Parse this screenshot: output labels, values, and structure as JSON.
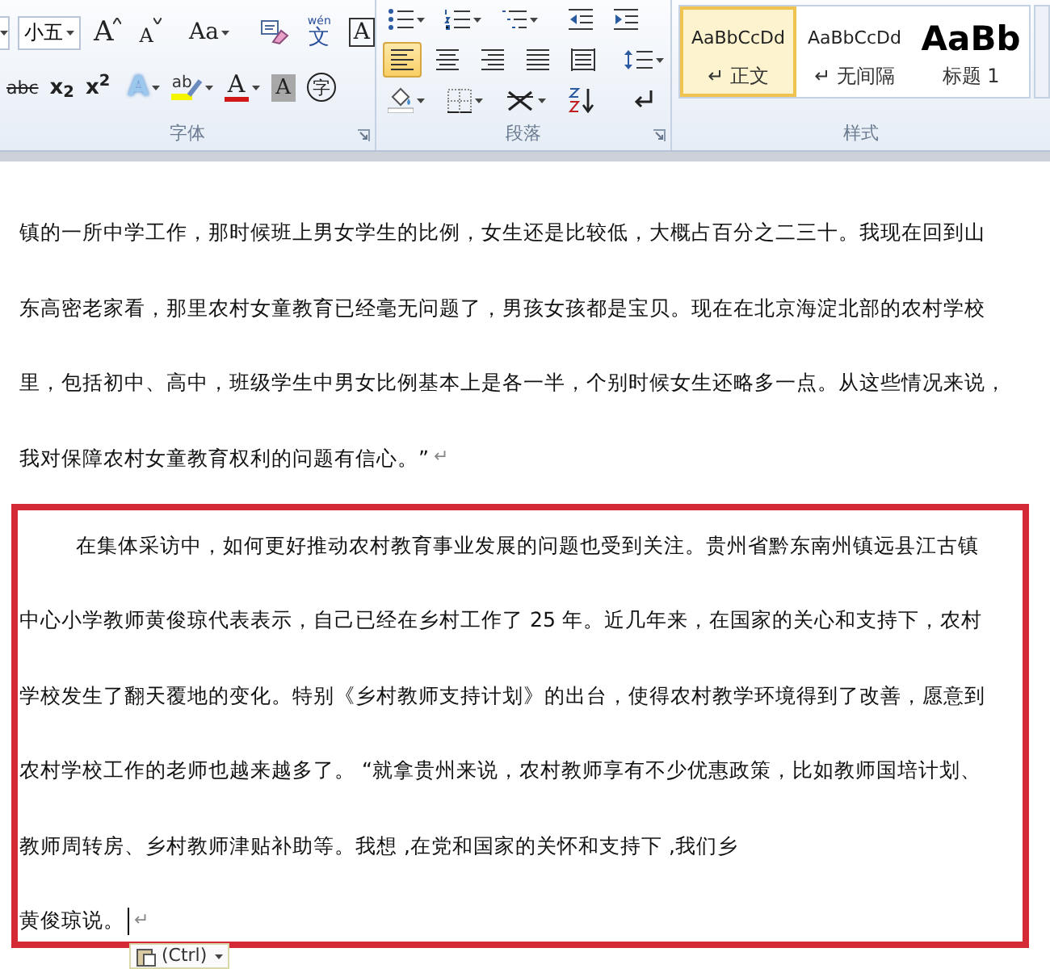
{
  "ribbon": {
    "font": {
      "label": "字体",
      "font_size": "小五",
      "buttons": [
        {
          "kind": "grow",
          "text": "A"
        },
        {
          "kind": "shrink",
          "text": "A"
        },
        {
          "kind": "case",
          "text": "Aa"
        },
        {
          "kind": "clear"
        },
        {
          "kind": "phonetic",
          "ruby": "wén",
          "text": "文"
        },
        {
          "kind": "border",
          "text": "A"
        },
        {
          "kind": "strike",
          "text": "abc"
        },
        {
          "kind": "sub",
          "text": "x$_{2}$"
        },
        {
          "kind": "sup",
          "text": "x$^{2}$"
        },
        {
          "kind": "effects",
          "text": "A"
        },
        {
          "kind": "highlight",
          "text": "ab"
        },
        {
          "kind": "color",
          "text": "A"
        },
        {
          "kind": "shading",
          "text": "A"
        },
        {
          "kind": "enclose",
          "text": "字"
        }
      ]
    },
    "paragraph": {
      "label": "段落",
      "alignment": [
        {
          "kind": "left",
          "selected": true
        },
        {
          "kind": "center",
          "selected": false
        },
        {
          "kind": "right",
          "selected": false
        },
        {
          "kind": "justify",
          "selected": false
        },
        {
          "kind": "distributed",
          "selected": false
        }
      ]
    },
    "styles": {
      "label": "样式",
      "items": [
        {
          "kind": "body",
          "preview": "AaBbCcDd",
          "name": "正文",
          "mark": "↵",
          "selected": true
        },
        {
          "kind": "body",
          "preview": "AaBbCcDd",
          "name": "无间隔",
          "mark": "↵",
          "selected": false
        },
        {
          "kind": "heading",
          "preview": "AaBb",
          "name": "标题 1",
          "selected": false
        }
      ]
    }
  },
  "document": {
    "paragraphs": [
      {
        "indent": false,
        "highlighted": false,
        "cursor": false,
        "mark": "↵",
        "lines": [
          "镇的一所中学工作，那时候班上男女学生的比例，女生还是比较低，大概占百分之二三十。我现在回到山",
          "东高密老家看，那里农村女童教育已经毫无问题了，男孩女孩都是宝贝。现在在北京海淀北部的农村学校",
          "里，包括初中、高中，班级学生中男女比例基本上是各一半，个别时候女生还略多一点。从这些情况来说，",
          "我对保障农村女童教育权利的问题有信心。”"
        ]
      },
      {
        "indent": true,
        "highlighted": true,
        "cursor": true,
        "mark": "↵",
        "lines": [
          "在集体采访中，如何更好推动农村教育事业发展的问题也受到关注。贵州省黔东南州镇远县江古镇",
          "中心小学教师黄俊琼代表表示，自己已经在乡村工作了 25 年。近几年来，在国家的关心和支持下，农村",
          "学校发生了翻天覆地的变化。特别《乡村教师支持计划》的出台，使得农村教学环境得到了改善，愿意到",
          "农村学校工作的老师也越来越多了。 “就拿贵州来说，农村教师享有不少优惠政策，比如教师国培计划、",
          "教师周转房、乡村教师津贴补助等。我想 ,在党和国家的关怀和支持下 ,我们乡",
          "黄俊琼说。"
        ]
      }
    ],
    "paste_options": {
      "label": "(Ctrl)"
    }
  }
}
